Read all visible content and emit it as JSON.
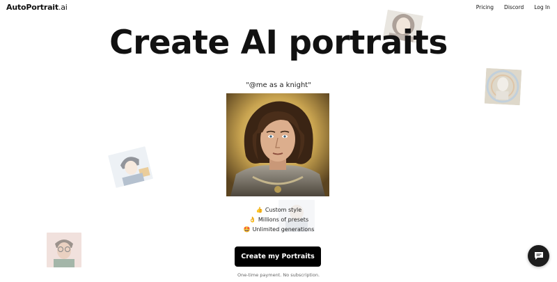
{
  "header": {
    "brand": "AutoPortrait",
    "tld": ".ai",
    "nav": [
      {
        "label": "Pricing"
      },
      {
        "label": "Discord"
      },
      {
        "label": "Log In"
      }
    ]
  },
  "hero": {
    "title": "Create AI portraits",
    "prompt": "\"@me as a knight\""
  },
  "features": [
    {
      "icon": "thumbs-up-icon",
      "emoji": "👍",
      "label": "Custom style"
    },
    {
      "icon": "ok-hand-icon",
      "emoji": "👌",
      "label": "Millions of presets"
    },
    {
      "icon": "star-struck-icon",
      "emoji": "🤩",
      "label": "Unlimited generations"
    }
  ],
  "cta": {
    "label": "Create my Portraits",
    "fine_print": "One-time payment. No subscription."
  },
  "chat": {
    "icon": "chat-bubble-icon"
  },
  "colors": {
    "primary": "#000000",
    "background": "#ffffff",
    "text": "#111111"
  }
}
